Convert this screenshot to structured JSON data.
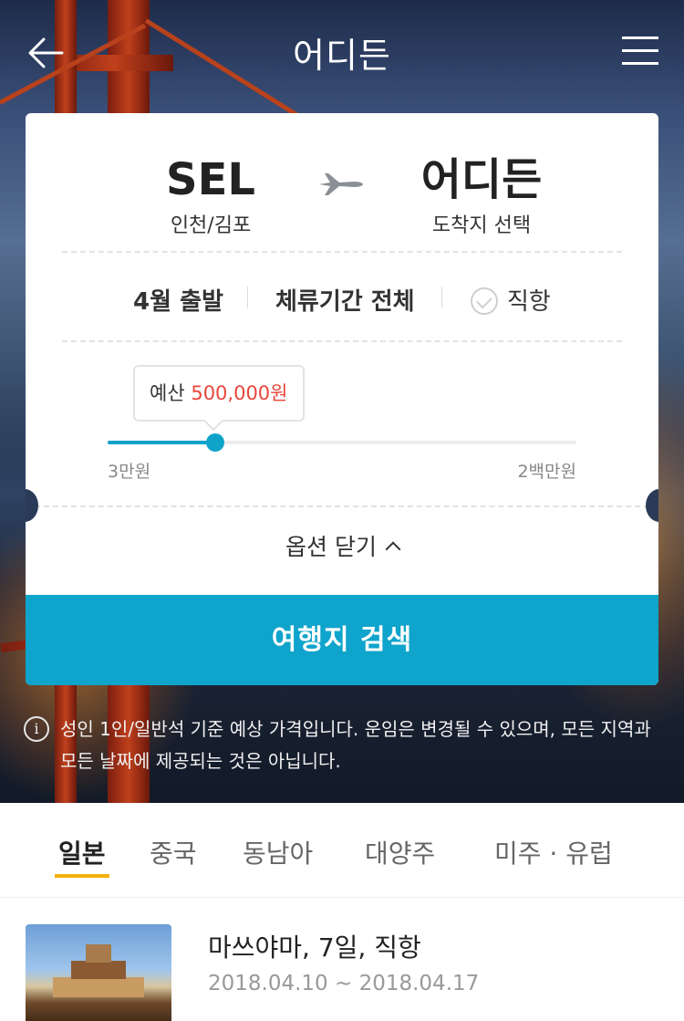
{
  "header": {
    "title": "어디든"
  },
  "search": {
    "origin": {
      "code": "SEL",
      "name": "인천/김포"
    },
    "destination": {
      "code": "어디든",
      "name": "도착지 선택"
    },
    "filters": {
      "month": "4월 출발",
      "stay": "체류기간 전체",
      "direct": "직항",
      "direct_checked": false
    },
    "budget": {
      "label": "예산",
      "value": "500,000원",
      "fraction": 0.23,
      "min_label": "3만원",
      "max_label": "2백만원"
    },
    "options_toggle": "옵션 닫기",
    "submit": "여행지 검색"
  },
  "notice": "성인 1인/일반석 기준 예상 가격입니다. 운임은 변경될 수 있으며, 모든 지역과 모든 날짜에 제공되는 것은 아닙니다.",
  "tabs": [
    {
      "label": "일본",
      "active": true
    },
    {
      "label": "중국",
      "active": false
    },
    {
      "label": "동남아",
      "active": false
    },
    {
      "label": "대양주",
      "active": false
    },
    {
      "label": "미주 · 유럽",
      "active": false
    }
  ],
  "results": [
    {
      "title": "마쓰야마, 7일, 직항",
      "dates": "2018.04.10 ~ 2018.04.17"
    }
  ],
  "colors": {
    "accent": "#0fa4cb",
    "price": "#e8453c",
    "tab_indicator": "#f2b00b"
  }
}
